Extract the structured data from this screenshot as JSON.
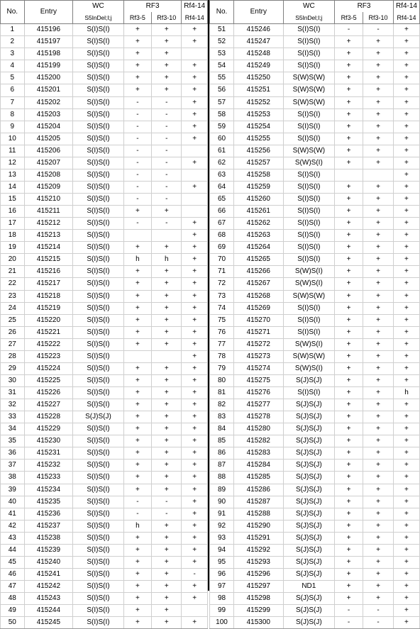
{
  "table": {
    "header": {
      "col_no": "No.",
      "col_entry": "Entry",
      "group_wc": "WC",
      "group_rf3": "RF3",
      "group_rf414": "Rf4-14",
      "sub_wc": "S5InDel;I;j",
      "sub_rf3_5": "Rf3-5",
      "sub_rf3_10": "Rf3-10",
      "sub_rf414": "Rf4-14"
    },
    "left_rows": [
      {
        "no": "1",
        "entry": "415196",
        "wc": "S(I)S(I)",
        "rf3_5": "+",
        "rf3_10": "+",
        "rf4_14": "+"
      },
      {
        "no": "2",
        "entry": "415197",
        "wc": "S(I)S(I)",
        "rf3_5": "+",
        "rf3_10": "+",
        "rf4_14": "+"
      },
      {
        "no": "3",
        "entry": "415198",
        "wc": "S(I)S(I)",
        "rf3_5": "+",
        "rf3_10": "+",
        "rf4_14": ""
      },
      {
        "no": "4",
        "entry": "415199",
        "wc": "S(I)S(I)",
        "rf3_5": "+",
        "rf3_10": "+",
        "rf4_14": "+"
      },
      {
        "no": "5",
        "entry": "415200",
        "wc": "S(I)S(I)",
        "rf3_5": "+",
        "rf3_10": "+",
        "rf4_14": "+"
      },
      {
        "no": "6",
        "entry": "415201",
        "wc": "S(I)S(I)",
        "rf3_5": "+",
        "rf3_10": "+",
        "rf4_14": "+"
      },
      {
        "no": "7",
        "entry": "415202",
        "wc": "S(I)S(I)",
        "rf3_5": "-",
        "rf3_10": "-",
        "rf4_14": "+"
      },
      {
        "no": "8",
        "entry": "415203",
        "wc": "S(I)S(I)",
        "rf3_5": "-",
        "rf3_10": "-",
        "rf4_14": "+"
      },
      {
        "no": "9",
        "entry": "415204",
        "wc": "S(I)S(I)",
        "rf3_5": "-",
        "rf3_10": "-",
        "rf4_14": "+"
      },
      {
        "no": "10",
        "entry": "415205",
        "wc": "S(I)S(I)",
        "rf3_5": "-",
        "rf3_10": "-",
        "rf4_14": "+"
      },
      {
        "no": "11",
        "entry": "415206",
        "wc": "S(I)S(I)",
        "rf3_5": "-",
        "rf3_10": "-",
        "rf4_14": ""
      },
      {
        "no": "12",
        "entry": "415207",
        "wc": "S(I)S(I)",
        "rf3_5": "-",
        "rf3_10": "-",
        "rf4_14": "+"
      },
      {
        "no": "13",
        "entry": "415208",
        "wc": "S(I)S(I)",
        "rf3_5": "-",
        "rf3_10": "-",
        "rf4_14": ""
      },
      {
        "no": "14",
        "entry": "415209",
        "wc": "S(I)S(I)",
        "rf3_5": "-",
        "rf3_10": "-",
        "rf4_14": "+"
      },
      {
        "no": "15",
        "entry": "415210",
        "wc": "S(I)S(I)",
        "rf3_5": "-",
        "rf3_10": "-",
        "rf4_14": ""
      },
      {
        "no": "16",
        "entry": "415211",
        "wc": "S(I)S(I)",
        "rf3_5": "+",
        "rf3_10": "+",
        "rf4_14": ""
      },
      {
        "no": "17",
        "entry": "415212",
        "wc": "S(I)S(I)",
        "rf3_5": "-",
        "rf3_10": "-",
        "rf4_14": "+"
      },
      {
        "no": "18",
        "entry": "415213",
        "wc": "S(I)S(I)",
        "rf3_5": "",
        "rf3_10": "",
        "rf4_14": "+"
      },
      {
        "no": "19",
        "entry": "415214",
        "wc": "S(I)S(I)",
        "rf3_5": "+",
        "rf3_10": "+",
        "rf4_14": "+"
      },
      {
        "no": "20",
        "entry": "415215",
        "wc": "S(I)S(I)",
        "rf3_5": "h",
        "rf3_10": "h",
        "rf4_14": "+"
      },
      {
        "no": "21",
        "entry": "415216",
        "wc": "S(I)S(I)",
        "rf3_5": "+",
        "rf3_10": "+",
        "rf4_14": "+"
      },
      {
        "no": "22",
        "entry": "415217",
        "wc": "S(I)S(I)",
        "rf3_5": "+",
        "rf3_10": "+",
        "rf4_14": "+"
      },
      {
        "no": "23",
        "entry": "415218",
        "wc": "S(I)S(I)",
        "rf3_5": "+",
        "rf3_10": "+",
        "rf4_14": "+"
      },
      {
        "no": "24",
        "entry": "415219",
        "wc": "S(I)S(I)",
        "rf3_5": "+",
        "rf3_10": "+",
        "rf4_14": "+"
      },
      {
        "no": "25",
        "entry": "415220",
        "wc": "S(I)S(I)",
        "rf3_5": "+",
        "rf3_10": "+",
        "rf4_14": "+"
      },
      {
        "no": "26",
        "entry": "415221",
        "wc": "S(I)S(I)",
        "rf3_5": "+",
        "rf3_10": "+",
        "rf4_14": "+"
      },
      {
        "no": "27",
        "entry": "415222",
        "wc": "S(I)S(I)",
        "rf3_5": "+",
        "rf3_10": "+",
        "rf4_14": "+"
      },
      {
        "no": "28",
        "entry": "415223",
        "wc": "S(I)S(I)",
        "rf3_5": "",
        "rf3_10": "",
        "rf4_14": "+"
      },
      {
        "no": "29",
        "entry": "415224",
        "wc": "S(I)S(I)",
        "rf3_5": "+",
        "rf3_10": "+",
        "rf4_14": "+"
      },
      {
        "no": "30",
        "entry": "415225",
        "wc": "S(I)S(I)",
        "rf3_5": "+",
        "rf3_10": "+",
        "rf4_14": "+"
      },
      {
        "no": "31",
        "entry": "415226",
        "wc": "S(I)S(I)",
        "rf3_5": "+",
        "rf3_10": "+",
        "rf4_14": "+"
      },
      {
        "no": "32",
        "entry": "415227",
        "wc": "S(I)S(I)",
        "rf3_5": "+",
        "rf3_10": "+",
        "rf4_14": "+"
      },
      {
        "no": "33",
        "entry": "415228",
        "wc": "S(J)S(J)",
        "rf3_5": "+",
        "rf3_10": "+",
        "rf4_14": "+"
      },
      {
        "no": "34",
        "entry": "415229",
        "wc": "S(I)S(I)",
        "rf3_5": "+",
        "rf3_10": "+",
        "rf4_14": "+"
      },
      {
        "no": "35",
        "entry": "415230",
        "wc": "S(I)S(I)",
        "rf3_5": "+",
        "rf3_10": "+",
        "rf4_14": "+"
      },
      {
        "no": "36",
        "entry": "415231",
        "wc": "S(I)S(I)",
        "rf3_5": "+",
        "rf3_10": "+",
        "rf4_14": "+"
      },
      {
        "no": "37",
        "entry": "415232",
        "wc": "S(I)S(I)",
        "rf3_5": "+",
        "rf3_10": "+",
        "rf4_14": "+"
      },
      {
        "no": "38",
        "entry": "415233",
        "wc": "S(I)S(I)",
        "rf3_5": "+",
        "rf3_10": "+",
        "rf4_14": "+"
      },
      {
        "no": "39",
        "entry": "415234",
        "wc": "S(I)S(I)",
        "rf3_5": "+",
        "rf3_10": "+",
        "rf4_14": "+"
      },
      {
        "no": "40",
        "entry": "415235",
        "wc": "S(I)S(I)",
        "rf3_5": "-",
        "rf3_10": "-",
        "rf4_14": "+"
      },
      {
        "no": "41",
        "entry": "415236",
        "wc": "S(I)S(I)",
        "rf3_5": "-",
        "rf3_10": "-",
        "rf4_14": "+"
      },
      {
        "no": "42",
        "entry": "415237",
        "wc": "S(I)S(I)",
        "rf3_5": "h",
        "rf3_10": "+",
        "rf4_14": "+"
      },
      {
        "no": "43",
        "entry": "415238",
        "wc": "S(I)S(I)",
        "rf3_5": "+",
        "rf3_10": "+",
        "rf4_14": "+"
      },
      {
        "no": "44",
        "entry": "415239",
        "wc": "S(I)S(I)",
        "rf3_5": "+",
        "rf3_10": "+",
        "rf4_14": "+"
      },
      {
        "no": "45",
        "entry": "415240",
        "wc": "S(I)S(I)",
        "rf3_5": "+",
        "rf3_10": "+",
        "rf4_14": "+"
      },
      {
        "no": "46",
        "entry": "415241",
        "wc": "S(I)S(I)",
        "rf3_5": "+",
        "rf3_10": "+",
        "rf4_14": "-"
      },
      {
        "no": "47",
        "entry": "415242",
        "wc": "S(I)S(I)",
        "rf3_5": "+",
        "rf3_10": "+",
        "rf4_14": "+"
      },
      {
        "no": "48",
        "entry": "415243",
        "wc": "S(I)S(I)",
        "rf3_5": "+",
        "rf3_10": "+",
        "rf4_14": "+"
      },
      {
        "no": "49",
        "entry": "415244",
        "wc": "S(I)S(I)",
        "rf3_5": "+",
        "rf3_10": "+",
        "rf4_14": ""
      },
      {
        "no": "50",
        "entry": "415245",
        "wc": "S(I)S(I)",
        "rf3_5": "+",
        "rf3_10": "+",
        "rf4_14": "+"
      }
    ],
    "right_rows": [
      {
        "no": "51",
        "entry": "415246",
        "wc": "S(I)S(I)",
        "rf3_5": "-",
        "rf3_10": "-",
        "rf4_14": "+"
      },
      {
        "no": "52",
        "entry": "415247",
        "wc": "S(I)S(I)",
        "rf3_5": "+",
        "rf3_10": "+",
        "rf4_14": "+"
      },
      {
        "no": "53",
        "entry": "415248",
        "wc": "S(I)S(I)",
        "rf3_5": "+",
        "rf3_10": "+",
        "rf4_14": "+"
      },
      {
        "no": "54",
        "entry": "415249",
        "wc": "S(I)S(I)",
        "rf3_5": "+",
        "rf3_10": "+",
        "rf4_14": "+"
      },
      {
        "no": "55",
        "entry": "415250",
        "wc": "S(W)S(W)",
        "rf3_5": "+",
        "rf3_10": "+",
        "rf4_14": "+"
      },
      {
        "no": "56",
        "entry": "415251",
        "wc": "S(W)S(W)",
        "rf3_5": "+",
        "rf3_10": "+",
        "rf4_14": "+"
      },
      {
        "no": "57",
        "entry": "415252",
        "wc": "S(W)S(W)",
        "rf3_5": "+",
        "rf3_10": "+",
        "rf4_14": "+"
      },
      {
        "no": "58",
        "entry": "415253",
        "wc": "S(I)S(I)",
        "rf3_5": "+",
        "rf3_10": "+",
        "rf4_14": "+"
      },
      {
        "no": "59",
        "entry": "415254",
        "wc": "S(I)S(I)",
        "rf3_5": "+",
        "rf3_10": "+",
        "rf4_14": "+"
      },
      {
        "no": "60",
        "entry": "415255",
        "wc": "S(I)S(I)",
        "rf3_5": "+",
        "rf3_10": "+",
        "rf4_14": "+"
      },
      {
        "no": "61",
        "entry": "415256",
        "wc": "S(W)S(W)",
        "rf3_5": "+",
        "rf3_10": "+",
        "rf4_14": "+"
      },
      {
        "no": "62",
        "entry": "415257",
        "wc": "S(W)S(I)",
        "rf3_5": "+",
        "rf3_10": "+",
        "rf4_14": "+"
      },
      {
        "no": "63",
        "entry": "415258",
        "wc": "S(I)S(I)",
        "rf3_5": "",
        "rf3_10": "",
        "rf4_14": "+"
      },
      {
        "no": "64",
        "entry": "415259",
        "wc": "S(I)S(I)",
        "rf3_5": "+",
        "rf3_10": "+",
        "rf4_14": "+"
      },
      {
        "no": "65",
        "entry": "415260",
        "wc": "S(I)S(I)",
        "rf3_5": "+",
        "rf3_10": "+",
        "rf4_14": "+"
      },
      {
        "no": "66",
        "entry": "415261",
        "wc": "S(I)S(I)",
        "rf3_5": "+",
        "rf3_10": "+",
        "rf4_14": "+"
      },
      {
        "no": "67",
        "entry": "415262",
        "wc": "S(I)S(I)",
        "rf3_5": "+",
        "rf3_10": "+",
        "rf4_14": "+"
      },
      {
        "no": "68",
        "entry": "415263",
        "wc": "S(I)S(I)",
        "rf3_5": "+",
        "rf3_10": "+",
        "rf4_14": "+"
      },
      {
        "no": "69",
        "entry": "415264",
        "wc": "S(I)S(I)",
        "rf3_5": "+",
        "rf3_10": "+",
        "rf4_14": "+"
      },
      {
        "no": "70",
        "entry": "415265",
        "wc": "S(I)S(I)",
        "rf3_5": "+",
        "rf3_10": "+",
        "rf4_14": "+"
      },
      {
        "no": "71",
        "entry": "415266",
        "wc": "S(W)S(I)",
        "rf3_5": "+",
        "rf3_10": "+",
        "rf4_14": "+"
      },
      {
        "no": "72",
        "entry": "415267",
        "wc": "S(W)S(I)",
        "rf3_5": "+",
        "rf3_10": "+",
        "rf4_14": "+"
      },
      {
        "no": "73",
        "entry": "415268",
        "wc": "S(W)S(W)",
        "rf3_5": "+",
        "rf3_10": "+",
        "rf4_14": "+"
      },
      {
        "no": "74",
        "entry": "415269",
        "wc": "S(I)S(I)",
        "rf3_5": "+",
        "rf3_10": "+",
        "rf4_14": "+"
      },
      {
        "no": "75",
        "entry": "415270",
        "wc": "S(I)S(I)",
        "rf3_5": "+",
        "rf3_10": "+",
        "rf4_14": "+"
      },
      {
        "no": "76",
        "entry": "415271",
        "wc": "S(I)S(I)",
        "rf3_5": "+",
        "rf3_10": "+",
        "rf4_14": "+"
      },
      {
        "no": "77",
        "entry": "415272",
        "wc": "S(W)S(I)",
        "rf3_5": "+",
        "rf3_10": "+",
        "rf4_14": "+"
      },
      {
        "no": "78",
        "entry": "415273",
        "wc": "S(W)S(W)",
        "rf3_5": "+",
        "rf3_10": "+",
        "rf4_14": "+"
      },
      {
        "no": "79",
        "entry": "415274",
        "wc": "S(W)S(I)",
        "rf3_5": "+",
        "rf3_10": "+",
        "rf4_14": "+"
      },
      {
        "no": "80",
        "entry": "415275",
        "wc": "S(J)S(J)",
        "rf3_5": "+",
        "rf3_10": "+",
        "rf4_14": "+"
      },
      {
        "no": "81",
        "entry": "415276",
        "wc": "S(I)S(I)",
        "rf3_5": "+",
        "rf3_10": "+",
        "rf4_14": "h"
      },
      {
        "no": "82",
        "entry": "415277",
        "wc": "S(J)S(J)",
        "rf3_5": "+",
        "rf3_10": "+",
        "rf4_14": "+"
      },
      {
        "no": "83",
        "entry": "415278",
        "wc": "S(J)S(J)",
        "rf3_5": "+",
        "rf3_10": "+",
        "rf4_14": "+"
      },
      {
        "no": "84",
        "entry": "415280",
        "wc": "S(J)S(J)",
        "rf3_5": "+",
        "rf3_10": "+",
        "rf4_14": "+"
      },
      {
        "no": "85",
        "entry": "415282",
        "wc": "S(J)S(J)",
        "rf3_5": "+",
        "rf3_10": "+",
        "rf4_14": "+"
      },
      {
        "no": "86",
        "entry": "415283",
        "wc": "S(J)S(J)",
        "rf3_5": "+",
        "rf3_10": "+",
        "rf4_14": "+"
      },
      {
        "no": "87",
        "entry": "415284",
        "wc": "S(J)S(J)",
        "rf3_5": "+",
        "rf3_10": "+",
        "rf4_14": "+"
      },
      {
        "no": "88",
        "entry": "415285",
        "wc": "S(J)S(J)",
        "rf3_5": "+",
        "rf3_10": "+",
        "rf4_14": "+"
      },
      {
        "no": "89",
        "entry": "415286",
        "wc": "S(J)S(J)",
        "rf3_5": "+",
        "rf3_10": "+",
        "rf4_14": "+"
      },
      {
        "no": "90",
        "entry": "415287",
        "wc": "S(J)S(J)",
        "rf3_5": "+",
        "rf3_10": "+",
        "rf4_14": "+"
      },
      {
        "no": "91",
        "entry": "415288",
        "wc": "S(J)S(J)",
        "rf3_5": "+",
        "rf3_10": "+",
        "rf4_14": "+"
      },
      {
        "no": "92",
        "entry": "415290",
        "wc": "S(J)S(J)",
        "rf3_5": "+",
        "rf3_10": "+",
        "rf4_14": "+"
      },
      {
        "no": "93",
        "entry": "415291",
        "wc": "S(J)S(J)",
        "rf3_5": "+",
        "rf3_10": "+",
        "rf4_14": "+"
      },
      {
        "no": "94",
        "entry": "415292",
        "wc": "S(J)S(J)",
        "rf3_5": "+",
        "rf3_10": "+",
        "rf4_14": "+"
      },
      {
        "no": "95",
        "entry": "415293",
        "wc": "S(J)S(J)",
        "rf3_5": "+",
        "rf3_10": "+",
        "rf4_14": "+"
      },
      {
        "no": "96",
        "entry": "415296",
        "wc": "S(J)S(J)",
        "rf3_5": "+",
        "rf3_10": "+",
        "rf4_14": "+"
      },
      {
        "no": "97",
        "entry": "415297",
        "wc": "ND1",
        "rf3_5": "+",
        "rf3_10": "+",
        "rf4_14": "+"
      },
      {
        "no": "98",
        "entry": "415298",
        "wc": "S(J)S(J)",
        "rf3_5": "+",
        "rf3_10": "+",
        "rf4_14": "+"
      },
      {
        "no": "99",
        "entry": "415299",
        "wc": "S(J)S(J)",
        "rf3_5": "-",
        "rf3_10": "-",
        "rf4_14": "+"
      },
      {
        "no": "100",
        "entry": "415300",
        "wc": "S(J)S(J)",
        "rf3_5": "-",
        "rf3_10": "-",
        "rf4_14": "+"
      }
    ]
  }
}
